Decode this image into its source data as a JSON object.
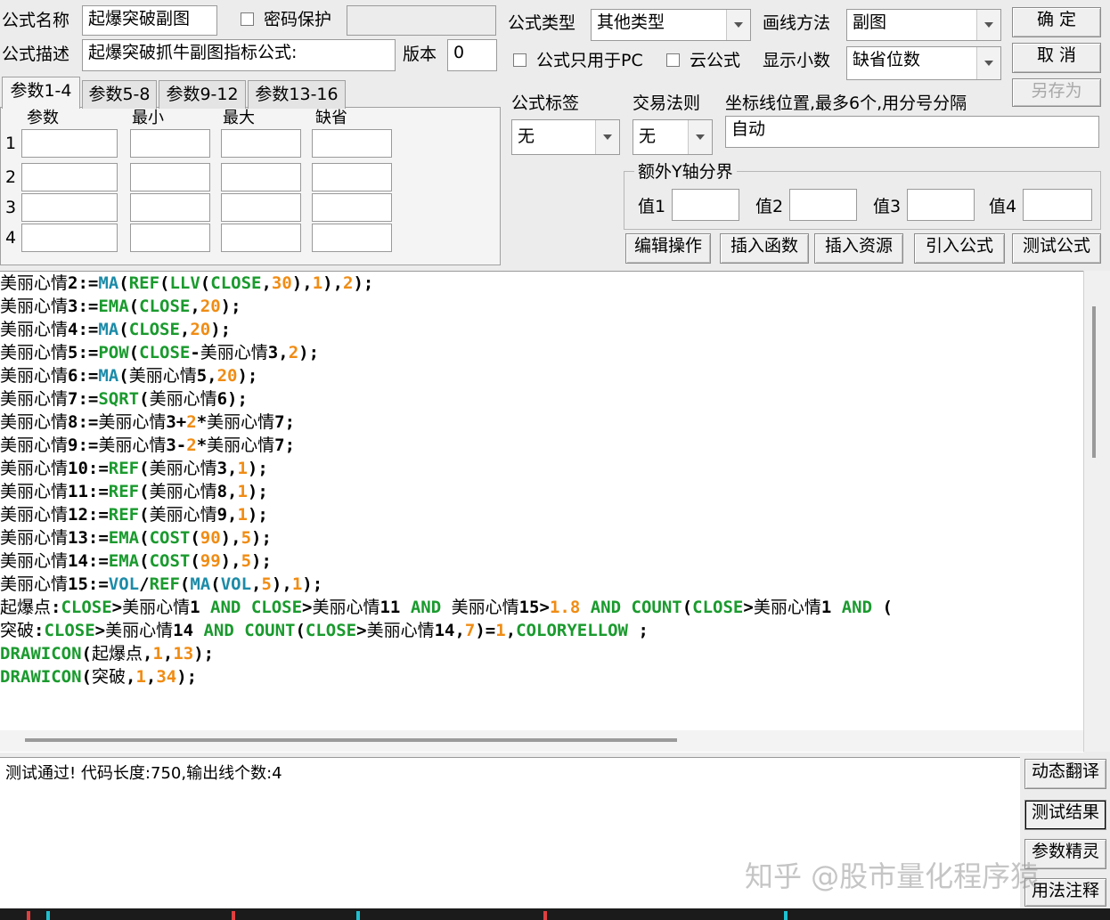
{
  "form": {
    "name_label": "公式名称",
    "name_value": "起爆突破副图",
    "password_label": "密码保护",
    "desc_label": "公式描述",
    "desc_value": "起爆突破抓牛副图指标公式:",
    "version_label": "版本",
    "version_value": "0",
    "type_label": "公式类型",
    "type_value": "其他类型",
    "draw_label": "画线方法",
    "draw_value": "副图",
    "pc_only_label": "公式只用于PC",
    "cloud_label": "云公式",
    "decimals_label": "显示小数",
    "decimals_value": "缺省位数",
    "tag_label": "公式标签",
    "tag_value": "无",
    "trade_label": "交易法则",
    "trade_value": "无",
    "axis_label": "坐标线位置,最多6个,用分号分隔",
    "axis_value": "自动",
    "yaxis_group_label": "额外Y轴分界",
    "y1_label": "值1",
    "y2_label": "值2",
    "y3_label": "值3",
    "y4_label": "值4"
  },
  "buttons": {
    "ok": "确  定",
    "cancel": "取  消",
    "save_as": "另存为",
    "edit_ops": "编辑操作",
    "insert_func": "插入函数",
    "insert_res": "插入资源",
    "import_formula": "引入公式",
    "test_formula": "测试公式",
    "dynamic_translate": "动态翻译",
    "test_result": "测试结果",
    "param_wizard": "参数精灵",
    "usage_notes": "用法注释"
  },
  "tabs": [
    "参数1-4",
    "参数5-8",
    "参数9-12",
    "参数13-16"
  ],
  "params": {
    "headers": [
      "参数",
      "最小",
      "最大",
      "缺省"
    ],
    "rows": [
      "1",
      "2",
      "3",
      "4"
    ]
  },
  "code_lines": [
    [
      [
        "t",
        "美丽心情"
      ],
      [
        "p",
        "2:="
      ],
      [
        "f",
        "MA"
      ],
      [
        "p",
        "("
      ],
      [
        "k",
        "REF"
      ],
      [
        "p",
        "("
      ],
      [
        "k",
        "LLV"
      ],
      [
        "p",
        "("
      ],
      [
        "k",
        "CLOSE"
      ],
      [
        "p",
        ","
      ],
      [
        "n",
        "30"
      ],
      [
        "p",
        "),"
      ],
      [
        "n",
        "1"
      ],
      [
        "p",
        "),"
      ],
      [
        "n",
        "2"
      ],
      [
        "p",
        ");"
      ]
    ],
    [
      [
        "t",
        "美丽心情"
      ],
      [
        "p",
        "3:="
      ],
      [
        "k",
        "EMA"
      ],
      [
        "p",
        "("
      ],
      [
        "k",
        "CLOSE"
      ],
      [
        "p",
        ","
      ],
      [
        "n",
        "20"
      ],
      [
        "p",
        ");"
      ]
    ],
    [
      [
        "t",
        "美丽心情"
      ],
      [
        "p",
        "4:="
      ],
      [
        "f",
        "MA"
      ],
      [
        "p",
        "("
      ],
      [
        "k",
        "CLOSE"
      ],
      [
        "p",
        ","
      ],
      [
        "n",
        "20"
      ],
      [
        "p",
        ");"
      ]
    ],
    [
      [
        "t",
        "美丽心情"
      ],
      [
        "p",
        "5:="
      ],
      [
        "k",
        "POW"
      ],
      [
        "p",
        "("
      ],
      [
        "k",
        "CLOSE"
      ],
      [
        "p",
        "-"
      ],
      [
        "t",
        "美丽心情"
      ],
      [
        "p",
        "3,"
      ],
      [
        "n",
        "2"
      ],
      [
        "p",
        ");"
      ]
    ],
    [
      [
        "t",
        "美丽心情"
      ],
      [
        "p",
        "6:="
      ],
      [
        "f",
        "MA"
      ],
      [
        "p",
        "("
      ],
      [
        "t",
        "美丽心情"
      ],
      [
        "p",
        "5,"
      ],
      [
        "n",
        "20"
      ],
      [
        "p",
        ");"
      ]
    ],
    [
      [
        "t",
        "美丽心情"
      ],
      [
        "p",
        "7:="
      ],
      [
        "k",
        "SQRT"
      ],
      [
        "p",
        "("
      ],
      [
        "t",
        "美丽心情"
      ],
      [
        "p",
        "6);"
      ]
    ],
    [
      [
        "t",
        "美丽心情"
      ],
      [
        "p",
        "8:="
      ],
      [
        "t",
        "美丽心情"
      ],
      [
        "p",
        "3+"
      ],
      [
        "n",
        "2"
      ],
      [
        "p",
        "*"
      ],
      [
        "t",
        "美丽心情"
      ],
      [
        "p",
        "7;"
      ]
    ],
    [
      [
        "t",
        "美丽心情"
      ],
      [
        "p",
        "9:="
      ],
      [
        "t",
        "美丽心情"
      ],
      [
        "p",
        "3-"
      ],
      [
        "n",
        "2"
      ],
      [
        "p",
        "*"
      ],
      [
        "t",
        "美丽心情"
      ],
      [
        "p",
        "7;"
      ]
    ],
    [
      [
        "t",
        "美丽心情"
      ],
      [
        "p",
        "10:="
      ],
      [
        "k",
        "REF"
      ],
      [
        "p",
        "("
      ],
      [
        "t",
        "美丽心情"
      ],
      [
        "p",
        "3,"
      ],
      [
        "n",
        "1"
      ],
      [
        "p",
        ");"
      ]
    ],
    [
      [
        "t",
        "美丽心情"
      ],
      [
        "p",
        "11:="
      ],
      [
        "k",
        "REF"
      ],
      [
        "p",
        "("
      ],
      [
        "t",
        "美丽心情"
      ],
      [
        "p",
        "8,"
      ],
      [
        "n",
        "1"
      ],
      [
        "p",
        ");"
      ]
    ],
    [
      [
        "t",
        "美丽心情"
      ],
      [
        "p",
        "12:="
      ],
      [
        "k",
        "REF"
      ],
      [
        "p",
        "("
      ],
      [
        "t",
        "美丽心情"
      ],
      [
        "p",
        "9,"
      ],
      [
        "n",
        "1"
      ],
      [
        "p",
        ");"
      ]
    ],
    [
      [
        "t",
        "美丽心情"
      ],
      [
        "p",
        "13:="
      ],
      [
        "k",
        "EMA"
      ],
      [
        "p",
        "("
      ],
      [
        "k",
        "COST"
      ],
      [
        "p",
        "("
      ],
      [
        "n",
        "90"
      ],
      [
        "p",
        "),"
      ],
      [
        "n",
        "5"
      ],
      [
        "p",
        ");"
      ]
    ],
    [
      [
        "t",
        "美丽心情"
      ],
      [
        "p",
        "14:="
      ],
      [
        "k",
        "EMA"
      ],
      [
        "p",
        "("
      ],
      [
        "k",
        "COST"
      ],
      [
        "p",
        "("
      ],
      [
        "n",
        "99"
      ],
      [
        "p",
        "),"
      ],
      [
        "n",
        "5"
      ],
      [
        "p",
        ");"
      ]
    ],
    [
      [
        "t",
        "美丽心情"
      ],
      [
        "p",
        "15:="
      ],
      [
        "f",
        "VOL"
      ],
      [
        "p",
        "/"
      ],
      [
        "k",
        "REF"
      ],
      [
        "p",
        "("
      ],
      [
        "f",
        "MA"
      ],
      [
        "p",
        "("
      ],
      [
        "f",
        "VOL"
      ],
      [
        "p",
        ","
      ],
      [
        "n",
        "5"
      ],
      [
        "p",
        "),"
      ],
      [
        "n",
        "1"
      ],
      [
        "p",
        ");"
      ]
    ],
    [
      [
        "t",
        "起爆点"
      ],
      [
        "p",
        ":"
      ],
      [
        "k",
        "CLOSE"
      ],
      [
        "p",
        ">"
      ],
      [
        "t",
        "美丽心情"
      ],
      [
        "p",
        "1 "
      ],
      [
        "k",
        "AND"
      ],
      [
        "p",
        " "
      ],
      [
        "k",
        "CLOSE"
      ],
      [
        "p",
        ">"
      ],
      [
        "t",
        "美丽心情"
      ],
      [
        "p",
        "11 "
      ],
      [
        "k",
        "AND"
      ],
      [
        "p",
        " "
      ],
      [
        "t",
        "美丽心情"
      ],
      [
        "p",
        "15>"
      ],
      [
        "n",
        "1.8"
      ],
      [
        "p",
        " "
      ],
      [
        "k",
        "AND"
      ],
      [
        "p",
        " "
      ],
      [
        "k",
        "COUNT"
      ],
      [
        "p",
        "("
      ],
      [
        "k",
        "CLOSE"
      ],
      [
        "p",
        ">"
      ],
      [
        "t",
        "美丽心情"
      ],
      [
        "p",
        "1 "
      ],
      [
        "k",
        "AND"
      ],
      [
        "p",
        " ("
      ]
    ],
    [
      [
        "t",
        "突破"
      ],
      [
        "p",
        ":"
      ],
      [
        "k",
        "CLOSE"
      ],
      [
        "p",
        ">"
      ],
      [
        "t",
        "美丽心情"
      ],
      [
        "p",
        "14 "
      ],
      [
        "k",
        "AND"
      ],
      [
        "p",
        " "
      ],
      [
        "k",
        "COUNT"
      ],
      [
        "p",
        "("
      ],
      [
        "k",
        "CLOSE"
      ],
      [
        "p",
        ">"
      ],
      [
        "t",
        "美丽心情"
      ],
      [
        "p",
        "14,"
      ],
      [
        "n",
        "7"
      ],
      [
        "p",
        ")="
      ],
      [
        "n",
        "1"
      ],
      [
        "p",
        ","
      ],
      [
        "k",
        "COLORYELLOW"
      ],
      [
        "p",
        " ;"
      ]
    ],
    [
      [
        "k",
        "DRAWICON"
      ],
      [
        "p",
        "("
      ],
      [
        "t",
        "起爆点"
      ],
      [
        "p",
        ","
      ],
      [
        "n",
        "1"
      ],
      [
        "p",
        ","
      ],
      [
        "n",
        "13"
      ],
      [
        "p",
        ");"
      ]
    ],
    [
      [
        "k",
        "DRAWICON"
      ],
      [
        "p",
        "("
      ],
      [
        "t",
        "突破"
      ],
      [
        "p",
        ","
      ],
      [
        "n",
        "1"
      ],
      [
        "p",
        ","
      ],
      [
        "n",
        "34"
      ],
      [
        "p",
        ");"
      ]
    ]
  ],
  "output": {
    "text": "测试通过! 代码长度:750,输出线个数:4"
  },
  "watermark": "知乎 @股市量化程序猿",
  "colors": {
    "function": "#1c8ba8",
    "keyword": "#1a9a2e",
    "number": "#f08c14"
  }
}
